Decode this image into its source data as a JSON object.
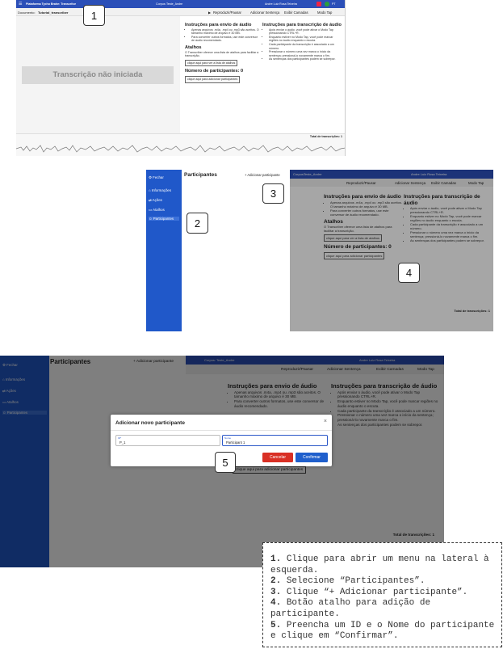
{
  "panel1": {
    "app_title": "Plataforma Tycho Brahe: Transcritor",
    "corpus_label": "Corpus:",
    "corpus_name": "Teste_Andre",
    "user_name": "Andre Luiz Rosa Teixeira",
    "lang_flag_label": "PT",
    "doc_label": "Documento:",
    "doc_name": "Tutorial_transcriber",
    "menu": [
      "Reproduzir/Pausar",
      "Adicionar Sentença",
      "Exibir Camadas",
      "Modo Tap"
    ],
    "status_text": "Transcrição não iniciada",
    "instructions": {
      "audio_title": "Instruções para envio de áudio",
      "audio_items": [
        "Apenas arquivos .m4a, .mp4 ou .mp3 são aceitos. O tamanho máximo de arquivo é 30 MB.",
        "Para converter outros formatos, use este conversor de áudio recomendado."
      ],
      "shortcuts_title": "Atalhos",
      "shortcuts_text": "O Transcriber oferece uma lista de atalhos para facilitar a transcrição.",
      "shortcuts_button": "clique aqui para ver a lista de atalhos",
      "participants_title": "Número de participantes: 0",
      "participants_button": "clique aqui para adicionar participantes",
      "transcription_title": "Instruções para transcrição de áudio",
      "transcription_items": [
        "Após enviar o áudio, você pode ativar o Modo Tap pressionando CTRL+R.",
        "Enquanto estiver no Modo Tap, você pode marcar regiões no áudio enquanto o escuta.",
        "Cada participante da transcrição é associado a um número.",
        "Pressionar o número uma vez marca o início da sentença; pressioná-lo novamente marca o fim.",
        "As sentenças dos participantes podem se sobrepor."
      ]
    },
    "total_label": "Total de transcrições: 1",
    "callout": "1"
  },
  "panel2": {
    "sidebar": {
      "close_label": "Fechar",
      "items": [
        "Informações",
        "Ações",
        "Atalhos",
        "Participantes"
      ]
    },
    "drawer_title": "Participantes",
    "add_participant_label": "+ Adicionar participante",
    "callouts": [
      "2",
      "3",
      "4"
    ]
  },
  "panel3": {
    "drawer_title": "Participantes",
    "add_participant_label": "+ Adicionar participante",
    "modal": {
      "title": "Adicionar novo participante",
      "close_symbol": "×",
      "id_label": "ID*",
      "id_value": "P_1",
      "name_label": "Nome",
      "name_value": "Participant 1",
      "cancel_label": "Cancelar",
      "confirm_label": "Confirmar"
    },
    "callout": "5"
  },
  "legend": [
    {
      "num": "1.",
      "text": "Clique para abrir um menu na lateral à esquerda."
    },
    {
      "num": "2.",
      "text": "Selecione “Participantes”."
    },
    {
      "num": "3.",
      "text": "Clique “+ Adicionar participante”."
    },
    {
      "num": "4.",
      "text": "Botão atalho para adição de participante."
    },
    {
      "num": "5.",
      "text": "Preencha um ID e o Nome do participante e clique em “Confirmar”."
    }
  ],
  "colors": {
    "header_blue": "#2b4fb8",
    "sidebar_blue": "#2058c9",
    "cancel_red": "#d93025",
    "confirm_blue": "#1f5fcc"
  }
}
